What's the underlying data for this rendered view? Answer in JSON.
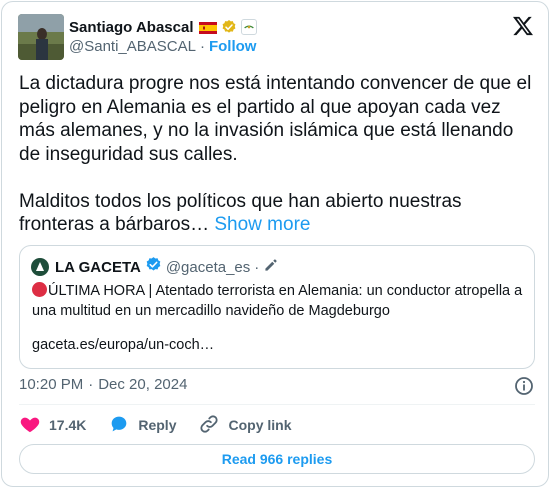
{
  "author": {
    "name": "Santiago Abascal",
    "handle": "@Santi_ABASCAL",
    "separator": "·",
    "follow_label": "Follow"
  },
  "tweet": {
    "text": "La dictadura progre nos está intentando convencer de que el peligro en Alemania es el partido al que apoyan cada vez más alemanes, y no la invasión islámica que está llenando de inseguridad sus calles.\n\nMalditos todos los políticos que han abierto nuestras fronteras a bárbaros…",
    "show_more_label": "Show more"
  },
  "quoted": {
    "name": "LA GACETA",
    "handle": "@gaceta_es",
    "separator": "·",
    "text": "ÚLTIMA HORA | Atentado terrorista en Alemania: un conductor atropella a una multitud en un mercadillo navideño de Magdeburgo",
    "link": "gaceta.es/europa/un-coch…"
  },
  "meta": {
    "time": "10:20 PM",
    "separator": "·",
    "date": "Dec 20, 2024"
  },
  "actions": {
    "likes": "17.4K",
    "reply_label": "Reply",
    "copy_link_label": "Copy link"
  },
  "read_replies_label": "Read 966 replies",
  "colors": {
    "accent": "#1d9bf0",
    "like": "#f91880",
    "muted_text": "#536471",
    "border": "#cfd9de"
  },
  "icons": [
    "x-logo-icon",
    "verified-gold-icon",
    "spain-flag-icon",
    "affiliate-badge-icon",
    "verified-blue-icon",
    "edit-pencil-icon",
    "info-icon",
    "heart-icon",
    "reply-bubble-icon",
    "link-icon"
  ]
}
